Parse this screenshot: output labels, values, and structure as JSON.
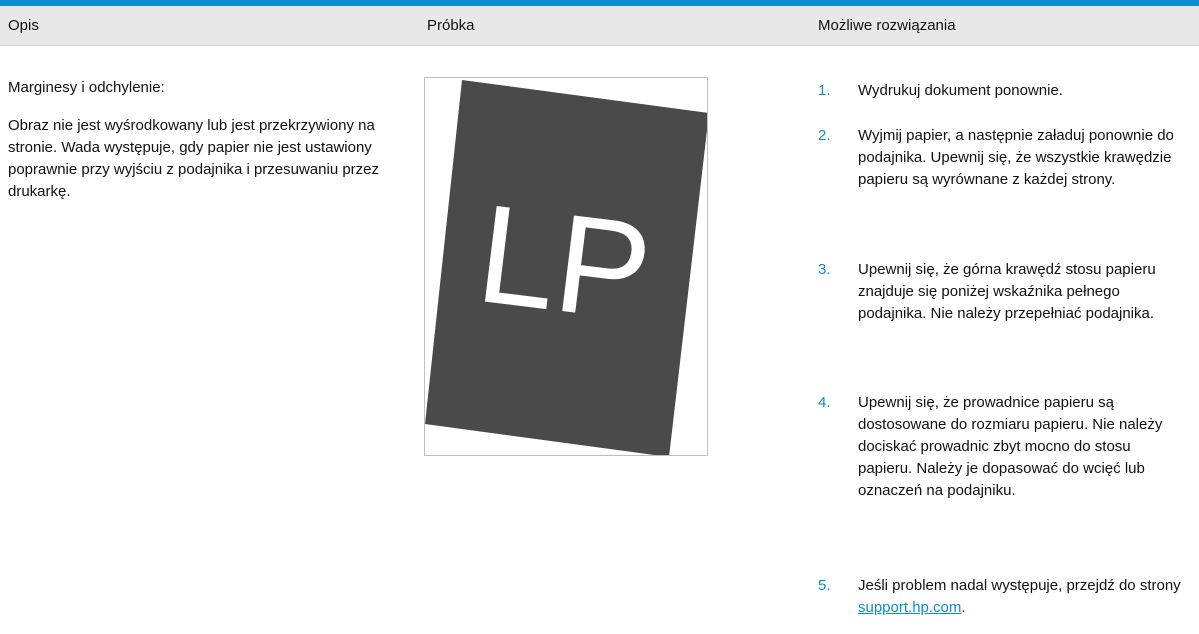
{
  "header": {
    "col_opis": "Opis",
    "col_probka": "Próbka",
    "col_rozwiazania": "Możliwe rozwiązania"
  },
  "description": {
    "title": "Marginesy i odchylenie:",
    "body": "Obraz nie jest wyśrodkowany lub jest przekrzywiony na stronie. Wada występuje, gdy papier nie jest ustawiony poprawnie przy wyjściu z podajnika i przesuwaniu przez drukarkę."
  },
  "sample": {
    "letters": "LP",
    "page_color": "#4a4a4a"
  },
  "solutions": [
    {
      "num": "1.",
      "text": "Wydrukuj dokument ponownie."
    },
    {
      "num": "2.",
      "text": "Wyjmij papier, a następnie załaduj ponownie do podajnika. Upewnij się, że wszystkie krawędzie papieru są wyrównane z każdej strony."
    },
    {
      "num": "3.",
      "text": "Upewnij się, że górna krawędź stosu papieru znajduje się poniżej wskaźnika pełnego podajnika. Nie należy przepełniać podajnika."
    },
    {
      "num": "4.",
      "text": "Upewnij się, że prowadnice papieru są dostosowane do rozmiaru papieru. Nie należy dociskać prowadnic zbyt mocno do stosu papieru. Należy je dopasować do wcięć lub oznaczeń na podajniku."
    },
    {
      "num": "5.",
      "text": "Jeśli problem nadal występuje, przejdź do strony",
      "link": "support.hp.com",
      "suffix": "."
    }
  ],
  "colors": {
    "accent": "#0b8ec9",
    "header_bg": "#e8e8e8"
  }
}
